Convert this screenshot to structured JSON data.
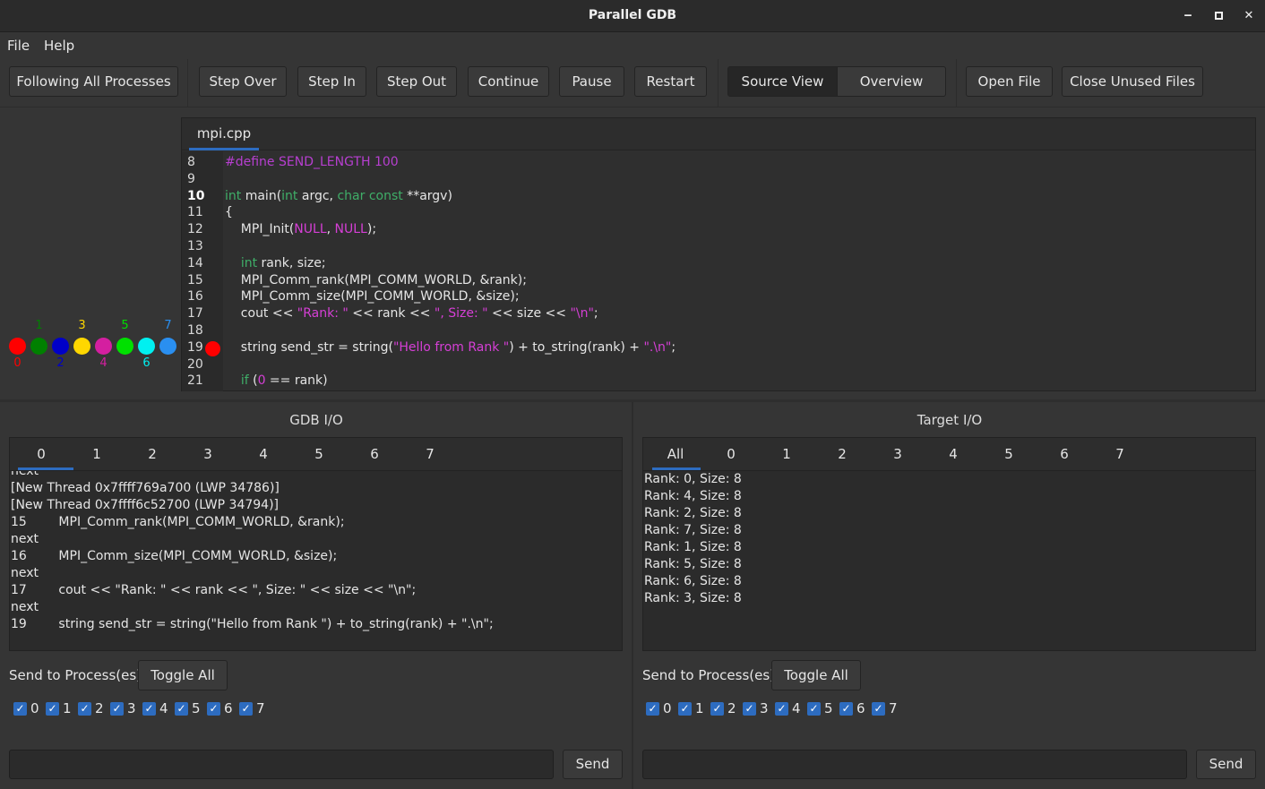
{
  "window": {
    "title": "Parallel GDB",
    "minimize_icon": "minimize-icon",
    "maximize_icon": "maximize-icon",
    "close_icon": "close-icon",
    "min_glyph": "‒",
    "max_glyph": "■",
    "close_glyph": "✕"
  },
  "menu": {
    "file": "File",
    "help": "Help"
  },
  "toolbar": {
    "follow": "Following All Processes",
    "step_over": "Step Over",
    "step_in": "Step In",
    "step_out": "Step Out",
    "continue": "Continue",
    "pause": "Pause",
    "restart": "Restart",
    "source_view": "Source View",
    "overview": "Overview",
    "open_file": "Open File",
    "close_unused": "Close Unused Files"
  },
  "ranks": [
    {
      "label": "0",
      "color": "#ff0000"
    },
    {
      "label": "1",
      "color": "#008000"
    },
    {
      "label": "2",
      "color": "#0000c8"
    },
    {
      "label": "3",
      "color": "#ffd700"
    },
    {
      "label": "4",
      "color": "#d41fa0"
    },
    {
      "label": "5",
      "color": "#00e000"
    },
    {
      "label": "6",
      "color": "#00f0f0"
    },
    {
      "label": "7",
      "color": "#2a8ff0"
    }
  ],
  "editor": {
    "file_tab": "mpi.cpp",
    "lines": [
      {
        "n": "8",
        "code": "#define SEND_LENGTH 100"
      },
      {
        "n": "9",
        "code": ""
      },
      {
        "n": "10",
        "code": "int main(int argc, char const **argv)"
      },
      {
        "n": "11",
        "code": "{"
      },
      {
        "n": "12",
        "code": "    MPI_Init(NULL, NULL);"
      },
      {
        "n": "13",
        "code": ""
      },
      {
        "n": "14",
        "code": "    int rank, size;"
      },
      {
        "n": "15",
        "code": "    MPI_Comm_rank(MPI_COMM_WORLD, &rank);"
      },
      {
        "n": "16",
        "code": "    MPI_Comm_size(MPI_COMM_WORLD, &size);"
      },
      {
        "n": "17",
        "code": "    cout << \"Rank: \" << rank << \", Size: \" << size << \"\\n\";"
      },
      {
        "n": "18",
        "code": ""
      },
      {
        "n": "19",
        "code": "    string send_str = string(\"Hello from Rank \") + to_string(rank) + \".\\n\";"
      },
      {
        "n": "20",
        "code": ""
      },
      {
        "n": "21",
        "code": "    if (0 == rank)"
      }
    ],
    "breakpoint_line": "19",
    "current_line": "10"
  },
  "gdb_io": {
    "title": "GDB I/O",
    "tabs": [
      "0",
      "1",
      "2",
      "3",
      "4",
      "5",
      "6",
      "7"
    ],
    "active_tab": "0",
    "lines": [
      "next",
      "[New Thread 0x7ffff769a700 (LWP 34786)]",
      "[New Thread 0x7ffff6c52700 (LWP 34794)]",
      "15        MPI_Comm_rank(MPI_COMM_WORLD, &rank);",
      "next",
      "16        MPI_Comm_size(MPI_COMM_WORLD, &size);",
      "next",
      "17        cout << \"Rank: \" << rank << \", Size: \" << size << \"\\n\";",
      "next",
      "19        string send_str = string(\"Hello from Rank \") + to_string(rank) + \".\\n\";"
    ],
    "send_label": "Send to Process(es):",
    "toggle_all": "Toggle All",
    "checks": [
      "0",
      "1",
      "2",
      "3",
      "4",
      "5",
      "6",
      "7"
    ],
    "input_value": "",
    "send": "Send"
  },
  "target_io": {
    "title": "Target I/O",
    "tabs": [
      "All",
      "0",
      "1",
      "2",
      "3",
      "4",
      "5",
      "6",
      "7"
    ],
    "active_tab": "All",
    "lines": [
      "Rank: 0, Size: 8",
      "Rank: 4, Size: 8",
      "Rank: 2, Size: 8",
      "Rank: 7, Size: 8",
      "Rank: 1, Size: 8",
      "Rank: 5, Size: 8",
      "Rank: 6, Size: 8",
      "Rank: 3, Size: 8"
    ],
    "send_label": "Send to Process(es):",
    "toggle_all": "Toggle All",
    "checks": [
      "0",
      "1",
      "2",
      "3",
      "4",
      "5",
      "6",
      "7"
    ],
    "input_value": "",
    "send": "Send"
  },
  "check_glyph": "✓"
}
